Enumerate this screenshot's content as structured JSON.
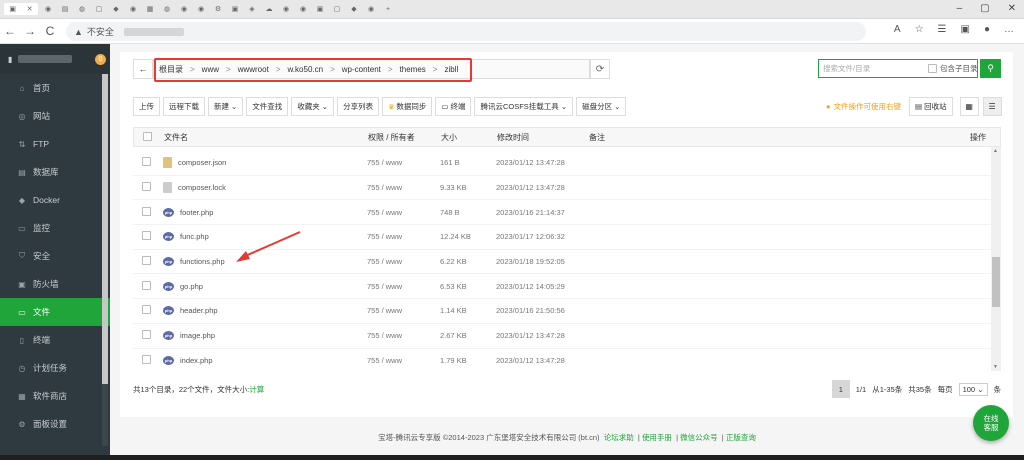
{
  "browser": {
    "address_insecure": "不安全",
    "nav": {
      "back": "←",
      "forward": "→",
      "reload": "C"
    }
  },
  "sidebar": {
    "badge": "0",
    "items": [
      {
        "label": "首页",
        "icon": "home-icon"
      },
      {
        "label": "网站",
        "icon": "globe-icon"
      },
      {
        "label": "FTP",
        "icon": "ftp-icon"
      },
      {
        "label": "数据库",
        "icon": "database-icon"
      },
      {
        "label": "Docker",
        "icon": "docker-icon"
      },
      {
        "label": "监控",
        "icon": "monitor-icon"
      },
      {
        "label": "安全",
        "icon": "shield-icon"
      },
      {
        "label": "防火墙",
        "icon": "firewall-icon"
      },
      {
        "label": "文件",
        "icon": "folder-icon",
        "active": true
      },
      {
        "label": "终端",
        "icon": "terminal-icon"
      },
      {
        "label": "计划任务",
        "icon": "clock-icon"
      },
      {
        "label": "软件商店",
        "icon": "store-icon"
      },
      {
        "label": "面板设置",
        "icon": "settings-icon"
      }
    ]
  },
  "path": {
    "crumbs": [
      "根目录",
      "www",
      "wwwroot",
      "w.ko50.cn",
      "wp-content",
      "themes",
      "zibll"
    ],
    "search_placeholder": "搜索文件/目录",
    "include_subdir": "包含子目录"
  },
  "toolbar": {
    "buttons": [
      "上传",
      "远程下载",
      "新建",
      "文件查找",
      "收藏夹",
      "分享列表",
      "数据同步",
      "终端",
      "腾讯云COSFS挂载工具",
      "磁盘分区"
    ],
    "warning": "文件操作可使用右键",
    "recycle": "回收站"
  },
  "table": {
    "headers": {
      "name": "文件名",
      "perm": "权限 / 所有者",
      "size": "大小",
      "time": "修改时间",
      "note": "备注",
      "action": "操作"
    },
    "rows": [
      {
        "name": "composer.json",
        "perm": "755 / www",
        "size": "161 B",
        "time": "2023/01/12 13:47:28",
        "type": "doc"
      },
      {
        "name": "composer.lock",
        "perm": "755 / www",
        "size": "9.33 KB",
        "time": "2023/01/12 13:47:28",
        "type": "gray"
      },
      {
        "name": "footer.php",
        "perm": "755 / www",
        "size": "748 B",
        "time": "2023/01/16 21:14:37",
        "type": "php"
      },
      {
        "name": "func.php",
        "perm": "755 / www",
        "size": "12.24 KB",
        "time": "2023/01/17 12:06:32",
        "type": "php"
      },
      {
        "name": "functions.php",
        "perm": "755 / www",
        "size": "6.22 KB",
        "time": "2023/01/18 19:52:05",
        "type": "php"
      },
      {
        "name": "go.php",
        "perm": "755 / www",
        "size": "6.53 KB",
        "time": "2023/01/12 14:05:29",
        "type": "php"
      },
      {
        "name": "header.php",
        "perm": "755 / www",
        "size": "1.14 KB",
        "time": "2023/01/16 21:50:56",
        "type": "php"
      },
      {
        "name": "image.php",
        "perm": "755 / www",
        "size": "2.67 KB",
        "time": "2023/01/12 13:47:28",
        "type": "php"
      },
      {
        "name": "index.php",
        "perm": "755 / www",
        "size": "1.79 KB",
        "time": "2023/01/12 13:47:28",
        "type": "php"
      }
    ]
  },
  "footer": {
    "stat_prefix": "共13个目录，22个文件，文件大小:",
    "stat_link": "计算",
    "page_current": "1",
    "page_info": "1/1",
    "page_range": "从1-35条",
    "page_total": "共35条",
    "per_page_label": "每页",
    "per_page_value": "100",
    "per_page_suffix": "条"
  },
  "copyright": {
    "text": "宝塔-腾讯云专享版 ©2014-2023 广东堡塔安全技术有限公司 (bt.cn)",
    "links": [
      "论坛求助",
      "使用手册",
      "微信公众号",
      "正版查询"
    ]
  },
  "float_button": "在线客服",
  "colors": {
    "accent": "#20a53a",
    "sidebar": "#2f3a40",
    "highlight": "#e53935"
  }
}
